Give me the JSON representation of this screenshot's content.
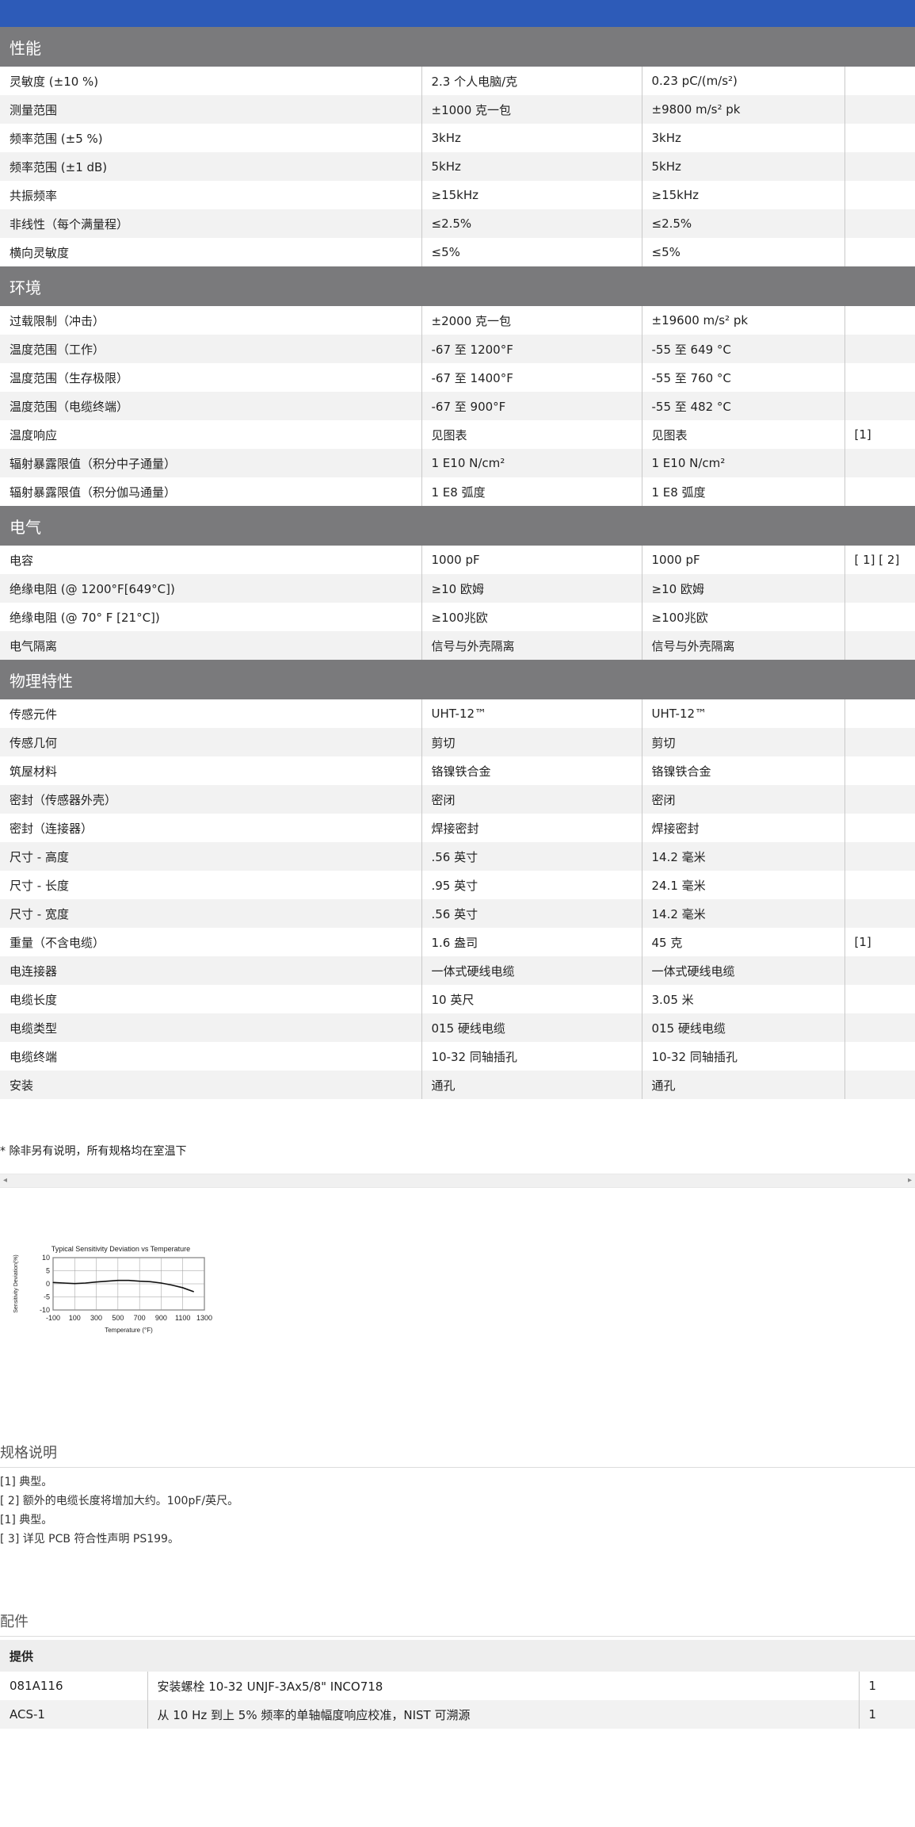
{
  "colors": {
    "header_bar": "#2d5bb8",
    "section_bar": "#7a7a7c",
    "row_alt": "#f2f2f2"
  },
  "sections": [
    {
      "title": "性能",
      "rows": [
        [
          "灵敏度 (±10 %)",
          "2.3 个人电脑/克",
          "0.23 pC/(m/s²)",
          ""
        ],
        [
          "测量范围",
          "±1000 克一包",
          "±9800 m/s² pk",
          ""
        ],
        [
          "频率范围 (±5 %)",
          "3kHz",
          "3kHz",
          ""
        ],
        [
          "频率范围 (±1 dB)",
          "5kHz",
          "5kHz",
          ""
        ],
        [
          "共振频率",
          "≥15kHz",
          "≥15kHz",
          ""
        ],
        [
          "非线性（每个满量程）",
          "≤2.5%",
          "≤2.5%",
          ""
        ],
        [
          "横向灵敏度",
          "≤5%",
          "≤5%",
          ""
        ]
      ]
    },
    {
      "title": "环境",
      "rows": [
        [
          "过载限制（冲击）",
          "±2000 克一包",
          "±19600 m/s² pk",
          ""
        ],
        [
          "温度范围（工作）",
          "-67 至 1200°F",
          "-55 至 649 °C",
          ""
        ],
        [
          "温度范围（生存极限）",
          "-67 至 1400°F",
          "-55 至 760 °C",
          ""
        ],
        [
          "温度范围（电缆终端）",
          "-67 至 900°F",
          "-55 至 482 °C",
          ""
        ],
        [
          "温度响应",
          "见图表",
          "见图表",
          "[1]"
        ],
        [
          "辐射暴露限值（积分中子通量）",
          "1 E10 N/cm²",
          "1 E10 N/cm²",
          ""
        ],
        [
          "辐射暴露限值（积分伽马通量）",
          "1 E8 弧度",
          "1 E8 弧度",
          ""
        ]
      ]
    },
    {
      "title": "电气",
      "rows": [
        [
          "电容",
          "1000 pF",
          "1000 pF",
          "[ 1] [ 2]"
        ],
        [
          "绝缘电阻 (@ 1200°F[649°C])",
          "≥10 欧姆",
          "≥10 欧姆",
          ""
        ],
        [
          "绝缘电阻 (@ 70° F [21°C])",
          "≥100兆欧",
          "≥100兆欧",
          ""
        ],
        [
          "电气隔离",
          "信号与外壳隔离",
          "信号与外壳隔离",
          ""
        ]
      ]
    },
    {
      "title": "物理特性",
      "rows": [
        [
          "传感元件",
          "UHT-12™",
          "UHT-12™",
          ""
        ],
        [
          "传感几何",
          "剪切",
          "剪切",
          ""
        ],
        [
          "筑屋材料",
          "铬镍铁合金",
          "铬镍铁合金",
          ""
        ],
        [
          "密封（传感器外壳）",
          "密闭",
          "密闭",
          ""
        ],
        [
          "密封（连接器）",
          "焊接密封",
          "焊接密封",
          ""
        ],
        [
          "尺寸 - 高度",
          ".56 英寸",
          "14.2 毫米",
          ""
        ],
        [
          "尺寸 - 长度",
          ".95 英寸",
          "24.1 毫米",
          ""
        ],
        [
          "尺寸 - 宽度",
          ".56 英寸",
          "14.2 毫米",
          ""
        ],
        [
          "重量（不含电缆）",
          "1.6 盎司",
          "45 克",
          "[1]"
        ],
        [
          "电连接器",
          "一体式硬线电缆",
          "一体式硬线电缆",
          ""
        ],
        [
          "电缆长度",
          "10 英尺",
          "3.05 米",
          ""
        ],
        [
          "电缆类型",
          "015 硬线电缆",
          "015 硬线电缆",
          ""
        ],
        [
          "电缆终端",
          "10-32 同轴插孔",
          "10-32 同轴插孔",
          ""
        ],
        [
          "安装",
          "通孔",
          "通孔",
          ""
        ]
      ]
    }
  ],
  "footnote": "* 除非另有说明，所有规格均在室温下",
  "chart_data": {
    "type": "line",
    "title": "Typical Sensitivity Deviation vs Temperature",
    "xlabel": "Temperature (°F)",
    "ylabel": "Sensitivity Deviation(%)",
    "xlim": [
      -100,
      1300
    ],
    "ylim": [
      -10,
      10
    ],
    "xticks": [
      "-100",
      "100",
      "300",
      "500",
      "700",
      "900",
      "1100",
      "1300"
    ],
    "yticks": [
      "10",
      "5",
      "0",
      "-5",
      "-10"
    ],
    "grid": true,
    "series": [
      {
        "x": [
          -100,
          0,
          100,
          200,
          300,
          400,
          500,
          600,
          700,
          800,
          900,
          1000,
          1100,
          1200
        ],
        "y": [
          0.5,
          0.3,
          0.1,
          0.3,
          0.7,
          1.0,
          1.3,
          1.3,
          1.0,
          0.8,
          0.3,
          -0.5,
          -1.5,
          -3.0
        ]
      }
    ]
  },
  "spec_notes": {
    "heading": "规格说明",
    "lines": [
      "[1] 典型。",
      "[ 2] 额外的电缆长度将增加大约。100pF/英尺。",
      "[1] 典型。",
      "[ 3] 详见 PCB 符合性声明 PS199。"
    ]
  },
  "accessories": {
    "heading": "配件",
    "table_header": "提供",
    "rows": [
      [
        "081A116",
        "安装螺栓 10-32 UNJF-3Ax5/8\" INCO718",
        "1"
      ],
      [
        "ACS-1",
        "从 10 Hz 到上 5% 频率的单轴幅度响应校准，NIST 可溯源",
        "1"
      ]
    ]
  }
}
